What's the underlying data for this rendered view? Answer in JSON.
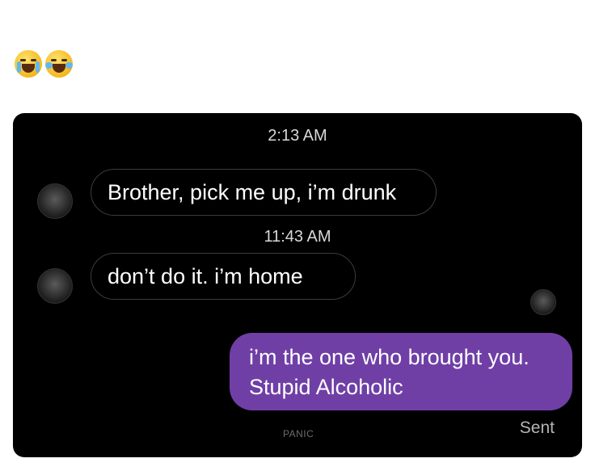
{
  "reactions": [
    {
      "icon": "loudly-crying-face-icon"
    },
    {
      "icon": "tears-of-joy-face-icon"
    }
  ],
  "chat": {
    "timestamp_1": "2:13 AM",
    "message_1": "Brother, pick me up, i’m drunk",
    "timestamp_2": "11:43 AM",
    "message_2": "don’t do it. i’m home",
    "reply_line_1": "i’m the one who brought you.",
    "reply_line_2": "Stupid Alcoholic",
    "watermark": "PANIC",
    "status": "Sent",
    "colors": {
      "background": "#000000",
      "outgoing_bubble": "#6f3fa6",
      "incoming_border": "#3c3c3c"
    }
  }
}
